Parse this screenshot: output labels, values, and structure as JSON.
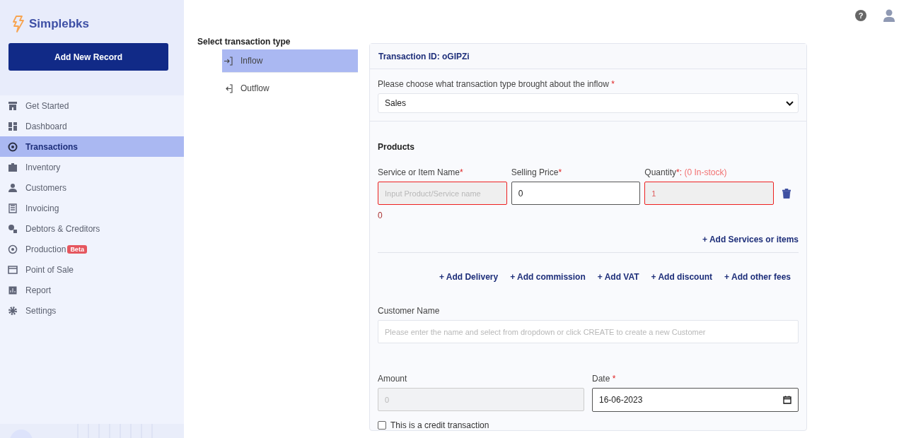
{
  "brand": {
    "name": "Simplebks"
  },
  "primary_button": "Add New Record",
  "help_glyph": "?",
  "sidebar": {
    "items": [
      {
        "label": "Get Started",
        "selected": false
      },
      {
        "label": "Dashboard",
        "selected": false
      },
      {
        "label": "Transactions",
        "selected": true
      },
      {
        "label": "Inventory",
        "selected": false
      },
      {
        "label": "Customers",
        "selected": false
      },
      {
        "label": "Invoicing",
        "selected": false
      },
      {
        "label": "Debtors & Creditors",
        "selected": false
      },
      {
        "label": "Production",
        "selected": false,
        "badge": "Beta"
      },
      {
        "label": "Point of Sale",
        "selected": false
      },
      {
        "label": "Report",
        "selected": false
      },
      {
        "label": "Settings",
        "selected": false
      }
    ]
  },
  "type_selector": {
    "title": "Select transaction type",
    "options": [
      {
        "label": "Inflow",
        "kind": "in",
        "selected": true
      },
      {
        "label": "Outflow",
        "kind": "out",
        "selected": false
      }
    ]
  },
  "form": {
    "transaction_id": "Transaction ID: oGIPZi",
    "type_question": {
      "label": "Please choose what transaction type brought about the inflow",
      "required_mark": "*",
      "value": "Sales"
    },
    "products_title": "Products",
    "product_row": {
      "name": {
        "label": "Service or Item Name",
        "required_mark": "*",
        "placeholder": "Input Product/Service name",
        "invalid": true
      },
      "price": {
        "label": "Selling Price",
        "required_mark": "*",
        "value": "0",
        "invalid": false
      },
      "quantity": {
        "label": "Quantity",
        "required_mark": "*:",
        "stock_note": "(0 In-stock)",
        "value": "1",
        "invalid": true
      },
      "line_total": "0"
    },
    "add_item_link": "+ Add Services or items",
    "extra_links": [
      "+ Add Delivery",
      "+ Add commission",
      "+ Add VAT",
      "+ Add discount",
      "+ Add other fees"
    ],
    "customer": {
      "label": "Customer Name",
      "placeholder": "Please enter the name and select from dropdown or click CREATE to create a new Customer"
    },
    "amount": {
      "label": "Amount",
      "placeholder": "0",
      "disabled": true
    },
    "date": {
      "label": "Date",
      "required_mark": "*",
      "value": "16-06-2023"
    },
    "credit": {
      "label": "This is a credit transaction",
      "checked": false
    }
  }
}
